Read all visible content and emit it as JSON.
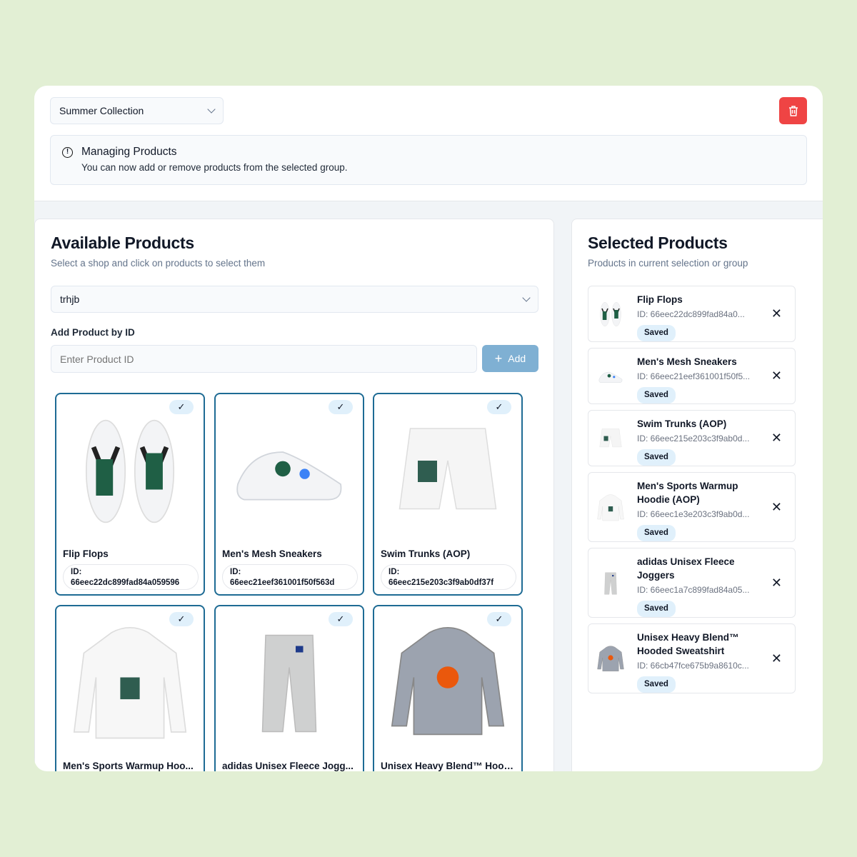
{
  "group_select": {
    "value": "Summer Collection"
  },
  "alert": {
    "title": "Managing Products",
    "description": "You can now add or remove products from the selected group."
  },
  "available": {
    "title": "Available Products",
    "subtitle": "Select a shop and click on products to select them",
    "shop_select": "trhjb",
    "add_label": "Add Product by ID",
    "input_placeholder": "Enter Product ID",
    "add_button": "Add",
    "products": [
      {
        "name": "Flip Flops",
        "id_label": "ID:",
        "id": "66eec22dc899fad84a059596",
        "selected": true
      },
      {
        "name": "Men's Mesh Sneakers",
        "id_label": "ID:",
        "id": "66eec21eef361001f50f563d",
        "selected": true
      },
      {
        "name": "Swim Trunks (AOP)",
        "id_label": "ID:",
        "id": "66eec215e203c3f9ab0df37f",
        "selected": true
      },
      {
        "name": "Men's Sports Warmup Hoo...",
        "selected": true
      },
      {
        "name": "adidas Unisex Fleece Jogg...",
        "selected": true
      },
      {
        "name": "Unisex Heavy Blend™ Hood...",
        "selected": true
      }
    ]
  },
  "selected": {
    "title": "Selected Products",
    "subtitle": "Products in current selection or group",
    "items": [
      {
        "name": "Flip Flops",
        "id": "ID: 66eec22dc899fad84a0...",
        "status": "Saved"
      },
      {
        "name": "Men's Mesh Sneakers",
        "id": "ID: 66eec21eef361001f50f5...",
        "status": "Saved"
      },
      {
        "name": "Swim Trunks (AOP)",
        "id": "ID: 66eec215e203c3f9ab0d...",
        "status": "Saved"
      },
      {
        "name": "Men's Sports Warmup Hoodie (AOP)",
        "id": "ID: 66eec1e3e203c3f9ab0d...",
        "status": "Saved"
      },
      {
        "name": "adidas Unisex Fleece Joggers",
        "id": "ID: 66eec1a7c899fad84a05...",
        "status": "Saved"
      },
      {
        "name": "Unisex Heavy Blend™ Hooded Sweatshirt",
        "id": "ID: 66cb47fce675b9a8610c...",
        "status": "Saved"
      }
    ]
  },
  "colors": {
    "accent": "#1e6b94",
    "danger": "#ef4444",
    "badge": "#e0f0fb",
    "background": "#e2efd4"
  }
}
